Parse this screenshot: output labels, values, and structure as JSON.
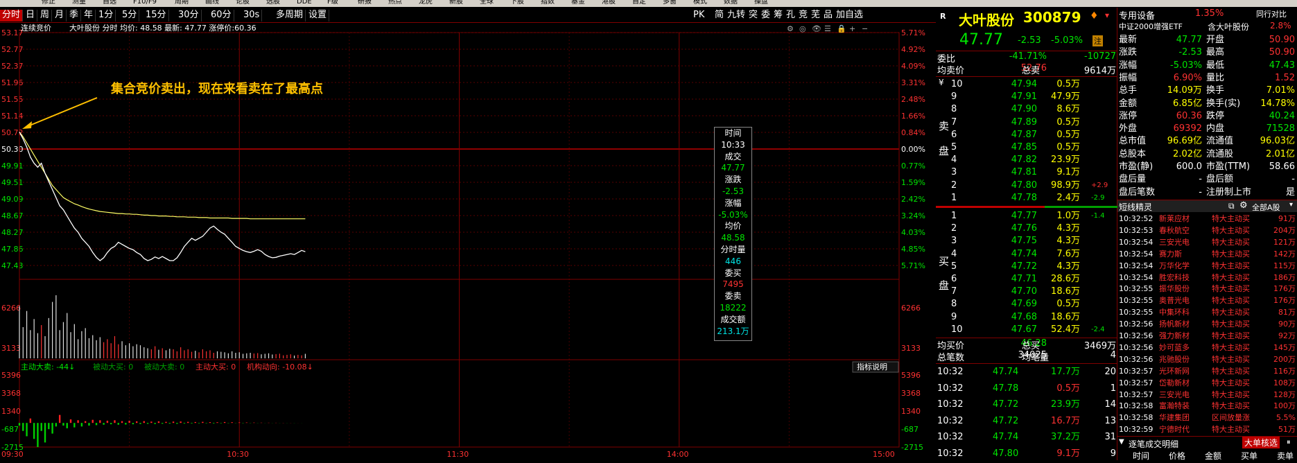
{
  "menu": [
    "修正",
    "测量",
    "自选",
    "F10/F9",
    "周期",
    "画线",
    "论股",
    "选股",
    "DDE",
    "F级",
    "研报",
    "热点",
    "龙虎",
    "新股",
    "全球",
    "下股",
    "指数",
    "基金",
    "港股",
    "自定",
    "多窗",
    "模式",
    "数据",
    "操盘"
  ],
  "toolbar": {
    "tabs": [
      "分时",
      "日",
      "周",
      "月",
      "季",
      "年",
      "1分",
      "5分",
      "15分",
      "30分",
      "60分",
      "30s",
      "多周期",
      "设置"
    ],
    "right": [
      "PK",
      "简",
      "九转",
      "突",
      "委",
      "筹",
      "孔",
      "竞",
      "芜",
      "品",
      "加自选"
    ]
  },
  "chart": {
    "auction_label": "连续竞价",
    "header": "大叶股份 分时 均价: 48.58 最新: 47.77 涨停价:60.36",
    "annotation": "集合竞价卖出，现在来看卖在了最高点",
    "left_prices": [
      "53.17",
      "52.77",
      "52.37",
      "51.96",
      "51.55",
      "51.14",
      "50.72",
      "50.30",
      "49.91",
      "49.51",
      "49.09",
      "48.67",
      "48.27",
      "47.86",
      "47.43"
    ],
    "right_pcts": [
      "5.71%",
      "4.92%",
      "4.09%",
      "3.31%",
      "2.48%",
      "1.66%",
      "0.84%",
      "0.00%",
      "0.77%",
      "1.59%",
      "2.42%",
      "3.24%",
      "4.03%",
      "4.85%",
      "5.71%"
    ],
    "vol_left": [
      "6266",
      "",
      "3133"
    ],
    "vol_right": [
      "6266",
      "",
      "3133"
    ],
    "flow_label_items": [
      {
        "t": "主动大卖: -44↓",
        "c": "#00e600"
      },
      {
        "t": "被动大买: 0",
        "c": "#00a000"
      },
      {
        "t": "被动大卖: 0",
        "c": "#00a000"
      },
      {
        "t": "主动大买: 0",
        "c": "#ff3232"
      },
      {
        "t": "机构动向: -10.08↓",
        "c": "#ff3232"
      }
    ],
    "flow_help": "指标说明",
    "flow_left": [
      "5396",
      "3368",
      "1340",
      "-687",
      "-2715"
    ],
    "flow_right": [
      "5396",
      "3368",
      "1340",
      "-687",
      "-2715"
    ],
    "time_axis": [
      "09:30",
      "10:30",
      "11:30",
      "14:00",
      "15:00"
    ],
    "price_series": [
      50.72,
      50.55,
      50.35,
      50.1,
      49.95,
      49.85,
      49.95,
      49.7,
      49.5,
      49.3,
      49.1,
      48.9,
      48.8,
      48.65,
      48.5,
      48.35,
      48.25,
      48.1,
      48.0,
      47.9,
      47.75,
      47.63,
      47.55,
      47.62,
      47.75,
      47.85,
      47.9,
      48.0,
      47.95,
      47.9,
      47.85,
      47.82,
      47.75,
      47.7,
      47.6,
      47.55,
      47.58,
      47.64,
      47.6,
      47.65,
      47.6,
      47.55,
      47.55,
      47.62,
      47.75,
      47.9,
      48.0,
      48.1,
      48.05,
      48.1,
      48.15,
      48.25,
      48.35,
      48.4,
      48.32,
      48.25,
      48.2,
      48.1,
      48.0,
      47.9,
      47.85,
      47.8,
      47.77,
      47.75,
      47.78,
      47.82,
      47.78,
      47.7,
      47.65,
      47.62,
      47.63,
      47.66,
      47.68,
      47.7,
      47.72,
      47.7,
      47.75,
      47.8,
      47.77
    ],
    "avg_series": [
      50.72,
      50.6,
      50.45,
      50.3,
      50.15,
      50.0,
      49.85,
      49.7,
      49.55,
      49.4,
      49.3,
      49.2,
      49.1,
      49.05,
      49.0,
      48.95,
      48.92,
      48.88,
      48.85,
      48.82,
      48.8,
      48.78,
      48.76,
      48.75,
      48.74,
      48.73,
      48.72,
      48.71,
      48.71,
      48.7,
      48.7,
      48.69,
      48.69,
      48.68,
      48.67,
      48.67,
      48.66,
      48.66,
      48.65,
      48.65,
      48.65,
      48.64,
      48.64,
      48.63,
      48.63,
      48.63,
      48.62,
      48.62,
      48.62,
      48.61,
      48.61,
      48.61,
      48.6,
      48.6,
      48.6,
      48.6,
      48.6,
      48.6,
      48.59,
      48.59,
      48.59,
      48.59,
      48.59,
      48.58,
      48.58,
      48.58,
      48.58,
      48.58,
      48.58,
      48.58,
      48.58,
      48.58,
      48.58,
      48.58,
      48.58,
      48.58,
      48.58,
      48.58,
      48.58
    ],
    "volumes": [
      5200,
      3100,
      4700,
      2800,
      3900,
      2500,
      3300,
      2200,
      4000,
      5600,
      6266,
      2800,
      3600,
      4500,
      2600,
      3400,
      1900,
      2700,
      3000,
      2000,
      2300,
      1800,
      2100,
      1600,
      1900,
      1500,
      2200,
      1400,
      1700,
      1300,
      1500,
      1200,
      1400,
      1300,
      1100,
      1000,
      900,
      1200,
      850,
      1000,
      800,
      950,
      900,
      700,
      1100,
      800,
      900,
      650,
      750,
      600,
      900,
      700,
      800,
      550,
      700,
      650,
      600,
      500,
      700,
      550,
      600,
      450,
      500,
      550,
      480,
      520,
      400,
      450,
      500,
      380,
      420,
      460,
      300,
      350,
      400,
      280,
      350,
      300,
      446
    ],
    "flows": [
      -300,
      -900,
      -1500,
      500,
      -1800,
      -2715,
      -900,
      -2200,
      -700,
      -1200,
      -400,
      900,
      -300,
      -600,
      400,
      -500,
      300,
      -400,
      200,
      -300,
      350,
      -250,
      300,
      -200,
      250,
      -150,
      300,
      -200,
      200,
      -180,
      250,
      -150,
      180,
      -120,
      200,
      -100,
      150,
      -120,
      180,
      -90,
      120,
      -80,
      150,
      -100,
      160,
      -70,
      120,
      -60,
      100,
      -50,
      120,
      -40,
      90,
      -60,
      80,
      -40,
      100,
      -30,
      80,
      -20,
      60,
      -30,
      50,
      -20,
      40,
      -15,
      30,
      -10,
      25,
      -10,
      20,
      -10,
      15,
      -10,
      10,
      -10,
      5,
      -5
    ],
    "tooltip": [
      {
        "t": "时间",
        "c": "#fff"
      },
      {
        "t": "10:33",
        "c": "#fff"
      },
      {
        "t": "成交",
        "c": "#fff"
      },
      {
        "t": "47.77",
        "c": "#00e600"
      },
      {
        "t": "涨跌",
        "c": "#fff"
      },
      {
        "t": "-2.53",
        "c": "#00e600"
      },
      {
        "t": "涨幅",
        "c": "#fff"
      },
      {
        "t": "-5.03%",
        "c": "#00e600"
      },
      {
        "t": "均价",
        "c": "#fff"
      },
      {
        "t": "48.58",
        "c": "#00e600"
      },
      {
        "t": "分时量",
        "c": "#fff"
      },
      {
        "t": "446",
        "c": "#00e5e5"
      },
      {
        "t": "委买",
        "c": "#fff"
      },
      {
        "t": "7495",
        "c": "#ff3232"
      },
      {
        "t": "委卖",
        "c": "#fff"
      },
      {
        "t": "18222",
        "c": "#00e600"
      },
      {
        "t": "成交额",
        "c": "#fff"
      },
      {
        "t": "213.1万",
        "c": "#00e5e5"
      }
    ]
  },
  "quote": {
    "name": "大叶股份",
    "code": "300879",
    "price": "47.77",
    "change": "-2.53",
    "pct": "-5.03%",
    "tag": "注",
    "weibi_label": "委比",
    "weibi": "-41.71%",
    "weicha": "-10727",
    "avgsell_label": "均卖价",
    "avgsell": "52.76",
    "totalsell_label": "总卖",
    "totalsell": "9614万",
    "sell_label": [
      "卖",
      "盘"
    ],
    "buy_label": [
      "买",
      "盘"
    ],
    "asks": [
      {
        "n": "10",
        "p": "47.94",
        "v": "0.5万",
        "x": ""
      },
      {
        "n": "9",
        "p": "47.91",
        "v": "47.9万",
        "x": ""
      },
      {
        "n": "8",
        "p": "47.90",
        "v": "8.6万",
        "x": ""
      },
      {
        "n": "7",
        "p": "47.89",
        "v": "0.5万",
        "x": ""
      },
      {
        "n": "6",
        "p": "47.87",
        "v": "0.5万",
        "x": ""
      },
      {
        "n": "5",
        "p": "47.85",
        "v": "0.5万",
        "x": ""
      },
      {
        "n": "4",
        "p": "47.82",
        "v": "23.9万",
        "x": ""
      },
      {
        "n": "3",
        "p": "47.81",
        "v": "9.1万",
        "x": ""
      },
      {
        "n": "2",
        "p": "47.80",
        "v": "98.9万",
        "x": "+2.9"
      },
      {
        "n": "1",
        "p": "47.78",
        "v": "2.4万",
        "x": "-2.9"
      }
    ],
    "bids": [
      {
        "n": "1",
        "p": "47.77",
        "v": "1.0万",
        "x": "-1.4"
      },
      {
        "n": "2",
        "p": "47.76",
        "v": "4.3万",
        "x": ""
      },
      {
        "n": "3",
        "p": "47.75",
        "v": "4.3万",
        "x": ""
      },
      {
        "n": "4",
        "p": "47.74",
        "v": "7.6万",
        "x": ""
      },
      {
        "n": "5",
        "p": "47.72",
        "v": "4.3万",
        "x": ""
      },
      {
        "n": "6",
        "p": "47.71",
        "v": "28.6万",
        "x": ""
      },
      {
        "n": "7",
        "p": "47.70",
        "v": "18.6万",
        "x": ""
      },
      {
        "n": "8",
        "p": "47.69",
        "v": "0.5万",
        "x": ""
      },
      {
        "n": "9",
        "p": "47.68",
        "v": "18.6万",
        "x": ""
      },
      {
        "n": "10",
        "p": "47.67",
        "v": "52.4万",
        "x": "-2.4"
      }
    ],
    "avgbuy_label": "均买价",
    "avgbuy": "46.28",
    "totalbuy_label": "总买",
    "totalbuy": "3469万",
    "trades_label": "总笔数",
    "trades": "34025",
    "perlot_label": "均笔量",
    "perlot": "4",
    "ticks": [
      {
        "t": "10:32",
        "p": "47.74",
        "v": "17.7万",
        "n": "20",
        "c": "#00e600"
      },
      {
        "t": "10:32",
        "p": "47.78",
        "v": "0.5万",
        "n": "1",
        "c": "#ff3232"
      },
      {
        "t": "10:32",
        "p": "47.72",
        "v": "23.9万",
        "n": "14",
        "c": "#00e600"
      },
      {
        "t": "10:32",
        "p": "47.72",
        "v": "16.7万",
        "n": "13",
        "c": "#ff3232"
      },
      {
        "t": "10:32",
        "p": "47.74",
        "v": "37.2万",
        "n": "31",
        "c": "#00e600"
      },
      {
        "t": "10:32",
        "p": "47.80",
        "v": "9.1万",
        "n": "9",
        "c": "#ff3232"
      }
    ]
  },
  "stats": {
    "sector": "专用设备",
    "sector_pct": "1.35%",
    "compare": "同行对比",
    "etf": "中证2000增强ETF",
    "etf_rel": "含大叶股份",
    "etf_pct": "2.8%",
    "rows": [
      {
        "a": "最新",
        "av": "47.77",
        "ac": "#00e600",
        "b": "开盘",
        "bv": "50.90",
        "bc": "#ff3232"
      },
      {
        "a": "涨跌",
        "av": "-2.53",
        "ac": "#00e600",
        "b": "最高",
        "bv": "50.90",
        "bc": "#ff3232"
      },
      {
        "a": "涨幅",
        "av": "-5.03%",
        "ac": "#00e600",
        "b": "最低",
        "bv": "47.43",
        "bc": "#00e600"
      },
      {
        "a": "振幅",
        "av": "6.90%",
        "ac": "#ff3232",
        "b": "量比",
        "bv": "1.52",
        "bc": "#ff3232"
      },
      {
        "a": "总手",
        "av": "14.09万",
        "ac": "#ffff00",
        "b": "换手",
        "bv": "7.01%",
        "bc": "#ffff00"
      },
      {
        "a": "金额",
        "av": "6.85亿",
        "ac": "#ffff00",
        "b": "换手(实)",
        "bv": "14.78%",
        "bc": "#ffff00"
      },
      {
        "a": "涨停",
        "av": "60.36",
        "ac": "#ff3232",
        "b": "跌停",
        "bv": "40.24",
        "bc": "#00e600"
      },
      {
        "a": "外盘",
        "av": "69392",
        "ac": "#ff3232",
        "b": "内盘",
        "bv": "71528",
        "bc": "#00e600"
      },
      {
        "a": "总市值",
        "av": "96.69亿",
        "ac": "#ffff00",
        "b": "流通值",
        "bv": "96.03亿",
        "bc": "#ffff00"
      },
      {
        "a": "总股本",
        "av": "2.02亿",
        "ac": "#ffff00",
        "b": "流通股",
        "bv": "2.01亿",
        "bc": "#ffff00"
      },
      {
        "a": "市盈(静)",
        "av": "600.0",
        "ac": "#fff",
        "b": "市盈(TTM)",
        "bv": "58.66",
        "bc": "#fff"
      },
      {
        "a": "盘后量",
        "av": "-",
        "ac": "#fff",
        "b": "盘后额",
        "bv": "-",
        "bc": "#fff"
      },
      {
        "a": "盘后笔数",
        "av": "-",
        "ac": "#fff",
        "b": "注册制上市",
        "bv": "是",
        "bc": "#fff"
      }
    ],
    "sprite_title": "短线精灵",
    "sprite_filter": "全部A股",
    "sprite": [
      {
        "t": "10:32:52",
        "n": "新莱应材",
        "e": "特大主动买",
        "v": "91万"
      },
      {
        "t": "10:32:53",
        "n": "春秋航空",
        "e": "特大主动买",
        "v": "204万"
      },
      {
        "t": "10:32:54",
        "n": "三安光电",
        "e": "特大主动买",
        "v": "121万"
      },
      {
        "t": "10:32:54",
        "n": "赛力斯",
        "e": "特大主动买",
        "v": "142万"
      },
      {
        "t": "10:32:54",
        "n": "万华化学",
        "e": "特大主动买",
        "v": "115万"
      },
      {
        "t": "10:32:54",
        "n": "胜宏科技",
        "e": "特大主动买",
        "v": "186万"
      },
      {
        "t": "10:32:55",
        "n": "振华股份",
        "e": "特大主动买",
        "v": "176万"
      },
      {
        "t": "10:32:55",
        "n": "奥普光电",
        "e": "特大主动买",
        "v": "176万"
      },
      {
        "t": "10:32:55",
        "n": "中集环科",
        "e": "特大主动买",
        "v": "81万"
      },
      {
        "t": "10:32:56",
        "n": "扬帆新材",
        "e": "特大主动买",
        "v": "90万"
      },
      {
        "t": "10:32:56",
        "n": "强力新材",
        "e": "特大主动买",
        "v": "92万"
      },
      {
        "t": "10:32:56",
        "n": "妙可蓝多",
        "e": "特大主动买",
        "v": "145万"
      },
      {
        "t": "10:32:56",
        "n": "兆驰股份",
        "e": "特大主动买",
        "v": "200万"
      },
      {
        "t": "10:32:57",
        "n": "光环新网",
        "e": "特大主动买",
        "v": "116万"
      },
      {
        "t": "10:32:57",
        "n": "岱勒新材",
        "e": "特大主动买",
        "v": "108万"
      },
      {
        "t": "10:32:57",
        "n": "三安光电",
        "e": "特大主动买",
        "v": "128万"
      },
      {
        "t": "10:32:58",
        "n": "富瀚特装",
        "e": "特大主动买",
        "v": "100万"
      },
      {
        "t": "10:32:58",
        "n": "华建集团",
        "e": "区间放量涨",
        "v": "5.5%"
      },
      {
        "t": "10:32:59",
        "n": "宁德时代",
        "e": "特大主动买",
        "v": "51万"
      }
    ],
    "detail_title": "逐笔成交明细",
    "bigorder": "大单核选",
    "detail_cols": [
      "时间",
      "价格",
      "金额",
      "买单",
      "卖单"
    ]
  }
}
